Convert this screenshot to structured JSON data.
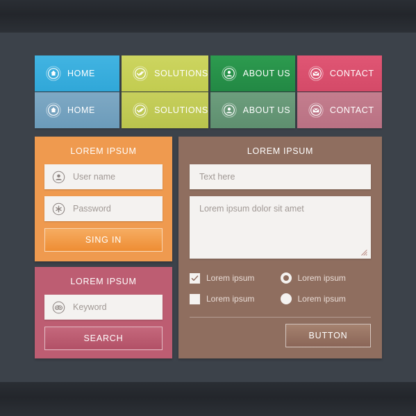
{
  "theme": {
    "bar_color": "#25282e",
    "canvas_color": "#3c424a",
    "accent_blue": "#30a7d8",
    "accent_green": "#c2cc50",
    "accent_teal": "#228844",
    "accent_pink": "#d44a68",
    "accent_orange": "#ef9a4f",
    "accent_red": "#bd5d72",
    "accent_brown": "#8f6e5f"
  },
  "nav": {
    "row_active": [
      {
        "label": "HOME",
        "icon": "home-icon"
      },
      {
        "label": "SOLUTIONS",
        "icon": "double-check-icon"
      },
      {
        "label": "ABOUT US",
        "icon": "user-icon"
      },
      {
        "label": "CONTACT",
        "icon": "envelope-icon"
      }
    ],
    "row_muted": [
      {
        "label": "HOME",
        "icon": "home-icon"
      },
      {
        "label": "SOLUTIONS",
        "icon": "double-check-icon"
      },
      {
        "label": "ABOUT US",
        "icon": "user-icon"
      },
      {
        "label": "CONTACT",
        "icon": "envelope-icon"
      }
    ]
  },
  "login_panel": {
    "title": "LOREM IPSUM",
    "username": {
      "placeholder": "User name",
      "icon": "user-icon"
    },
    "password": {
      "placeholder": "Password",
      "icon": "asterisk-icon"
    },
    "submit_label": "SING IN"
  },
  "search_panel": {
    "title": "LOREM IPSUM",
    "keyword": {
      "placeholder": "Keyword",
      "icon": "binoculars-icon"
    },
    "submit_label": "SEARCH"
  },
  "form_panel": {
    "title": "LOREM IPSUM",
    "text_input": {
      "placeholder": "Text here"
    },
    "textarea": {
      "placeholder": "Lorem ipsum dolor sit amet"
    },
    "options": [
      {
        "type": "checkbox",
        "label": "Lorem ipsum",
        "checked": true
      },
      {
        "type": "radio",
        "label": "Lorem ipsum",
        "checked": true
      },
      {
        "type": "checkbox",
        "label": "Lorem ipsum",
        "checked": false
      },
      {
        "type": "radio",
        "label": "Lorem ipsum",
        "checked": false
      }
    ],
    "submit_label": "BUTTON"
  }
}
